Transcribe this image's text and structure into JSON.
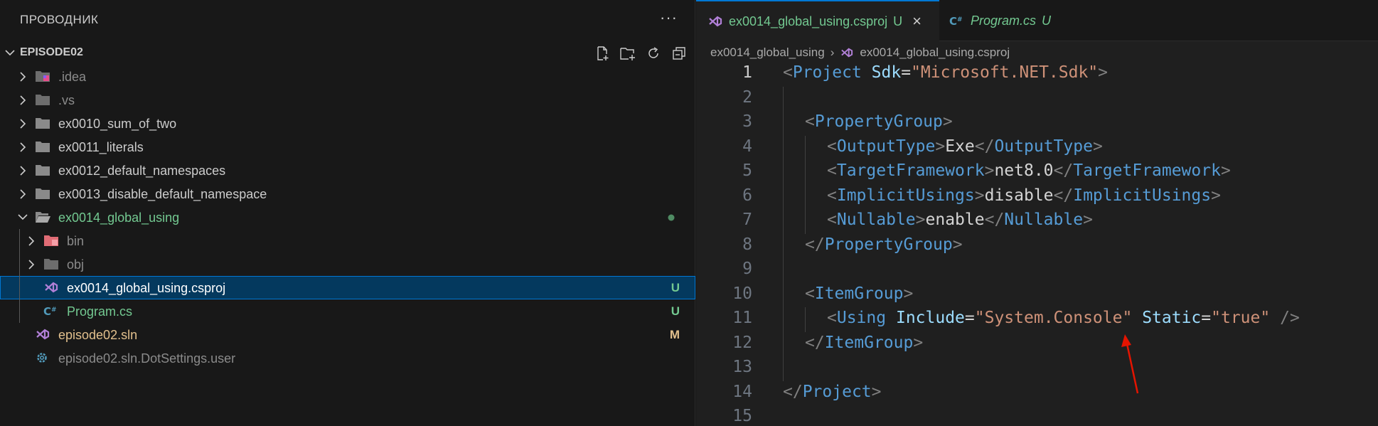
{
  "sidebar": {
    "title": "ПРОВОДНИК",
    "more": "···",
    "section_title": "EPISODE02",
    "items": [
      {
        "label": ".idea"
      },
      {
        "label": ".vs"
      },
      {
        "label": "ex0010_sum_of_two"
      },
      {
        "label": "ex0011_literals"
      },
      {
        "label": "ex0012_default_namespaces"
      },
      {
        "label": "ex0013_disable_default_namespace"
      },
      {
        "label": "ex0014_global_using"
      },
      {
        "label": "bin"
      },
      {
        "label": "obj"
      },
      {
        "label": "ex0014_global_using.csproj",
        "decoration": "U"
      },
      {
        "label": "Program.cs",
        "decoration": "U"
      },
      {
        "label": "episode02.sln",
        "decoration": "M"
      },
      {
        "label": "episode02.sln.DotSettings.user"
      }
    ]
  },
  "editor": {
    "tabs": [
      {
        "label": "ex0014_global_using.csproj",
        "status": "U",
        "close": "×"
      },
      {
        "label": "Program.cs",
        "status": "U"
      }
    ],
    "breadcrumb": [
      "ex0014_global_using",
      "›",
      "ex0014_global_using.csproj"
    ],
    "line_numbers": [
      "1",
      "2",
      "3",
      "4",
      "5",
      "6",
      "7",
      "8",
      "9",
      "10",
      "11",
      "12",
      "13",
      "14",
      "15"
    ],
    "code": {
      "l1": {
        "lt": "<",
        "tag": "Project",
        "attr": "Sdk",
        "eq": "=",
        "val": "\"Microsoft.NET.Sdk\"",
        "gt": ">"
      },
      "l3": {
        "lt": "<",
        "tag": "PropertyGroup",
        "gt": ">"
      },
      "l4": {
        "lt": "<",
        "tag": "OutputType",
        "gt": ">",
        "text": "Exe",
        "clt": "</",
        "ctag": "OutputType",
        "cgt": ">"
      },
      "l5": {
        "lt": "<",
        "tag": "TargetFramework",
        "gt": ">",
        "text": "net8.0",
        "clt": "</",
        "ctag": "TargetFramework",
        "cgt": ">"
      },
      "l6": {
        "lt": "<",
        "tag": "ImplicitUsings",
        "gt": ">",
        "text": "disable",
        "clt": "</",
        "ctag": "ImplicitUsings",
        "cgt": ">"
      },
      "l7": {
        "lt": "<",
        "tag": "Nullable",
        "gt": ">",
        "text": "enable",
        "clt": "</",
        "ctag": "Nullable",
        "cgt": ">"
      },
      "l8": {
        "clt": "</",
        "ctag": "PropertyGroup",
        "cgt": ">"
      },
      "l10": {
        "lt": "<",
        "tag": "ItemGroup",
        "gt": ">"
      },
      "l11": {
        "lt": "<",
        "tag": "Using",
        "attr1": "Include",
        "eq": "=",
        "val1": "\"System.Console\"",
        "attr2": "Static",
        "val2": "\"true\"",
        "close": "/>"
      },
      "l12": {
        "clt": "</",
        "ctag": "ItemGroup",
        "cgt": ">"
      },
      "l14": {
        "clt": "</",
        "ctag": "Project",
        "cgt": ">"
      }
    }
  },
  "colors": {
    "accent": "#0078d4",
    "untracked": "#73c991",
    "modified": "#e2c08d",
    "annotation_arrow": "#e51400"
  }
}
